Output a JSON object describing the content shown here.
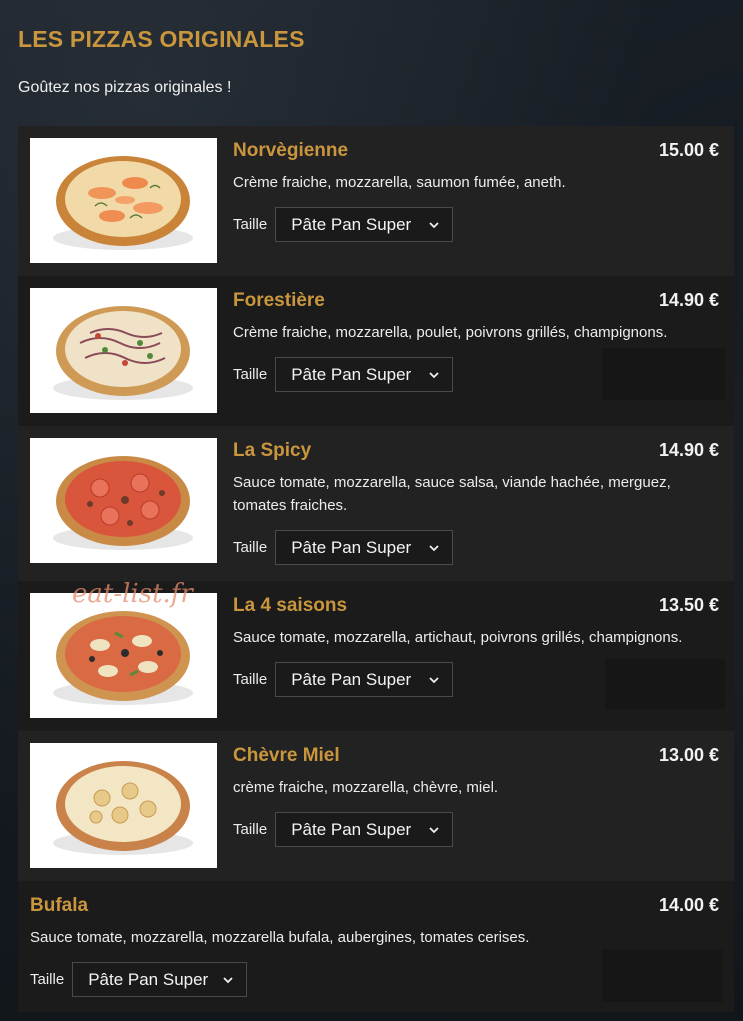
{
  "header": {
    "title": "LES PIZZAS ORIGINALES",
    "intro": "Goûtez nos pizzas originales !"
  },
  "size_label": "Taille",
  "items": [
    {
      "name": "Norvègienne",
      "price": "15.00 €",
      "description": "Crème fraiche, mozzarella, saumon fumée, aneth.",
      "size_value": "Pâte Pan Super",
      "has_image": true
    },
    {
      "name": "Forestière",
      "price": "14.90 €",
      "description": "Crème fraiche, mozzarella, poulet, poivrons grillés, champignons.",
      "size_value": "Pâte Pan Super",
      "has_image": true
    },
    {
      "name": "La Spicy",
      "price": "14.90 €",
      "description": "Sauce tomate, mozzarella, sauce salsa, viande hachée, merguez, tomates fraiches.",
      "size_value": "Pâte Pan Super",
      "has_image": true
    },
    {
      "name": "La 4 saisons",
      "price": "13.50 €",
      "description": "Sauce tomate, mozzarella, artichaut, poivrons grillés, champignons.",
      "size_value": "Pâte Pan Super",
      "has_image": true
    },
    {
      "name": "Chèvre Miel",
      "price": "13.00 €",
      "description": "crème fraiche, mozzarella, chèvre, miel.",
      "size_value": "Pâte Pan Super",
      "has_image": true
    },
    {
      "name": "Bufala",
      "price": "14.00 €",
      "description": "Sauce tomate, mozzarella, mozzarella bufala, aubergines, tomates cerises.",
      "size_value": "Pâte Pan Super",
      "has_image": false
    }
  ],
  "watermark": "eat-list.fr",
  "icons": {
    "dropdown": "chevron-down-icon"
  },
  "colors": {
    "accent": "#c9963d",
    "price": "#f2f2f2",
    "row_alt": "#222222",
    "row_dark": "#1b1b1b"
  }
}
